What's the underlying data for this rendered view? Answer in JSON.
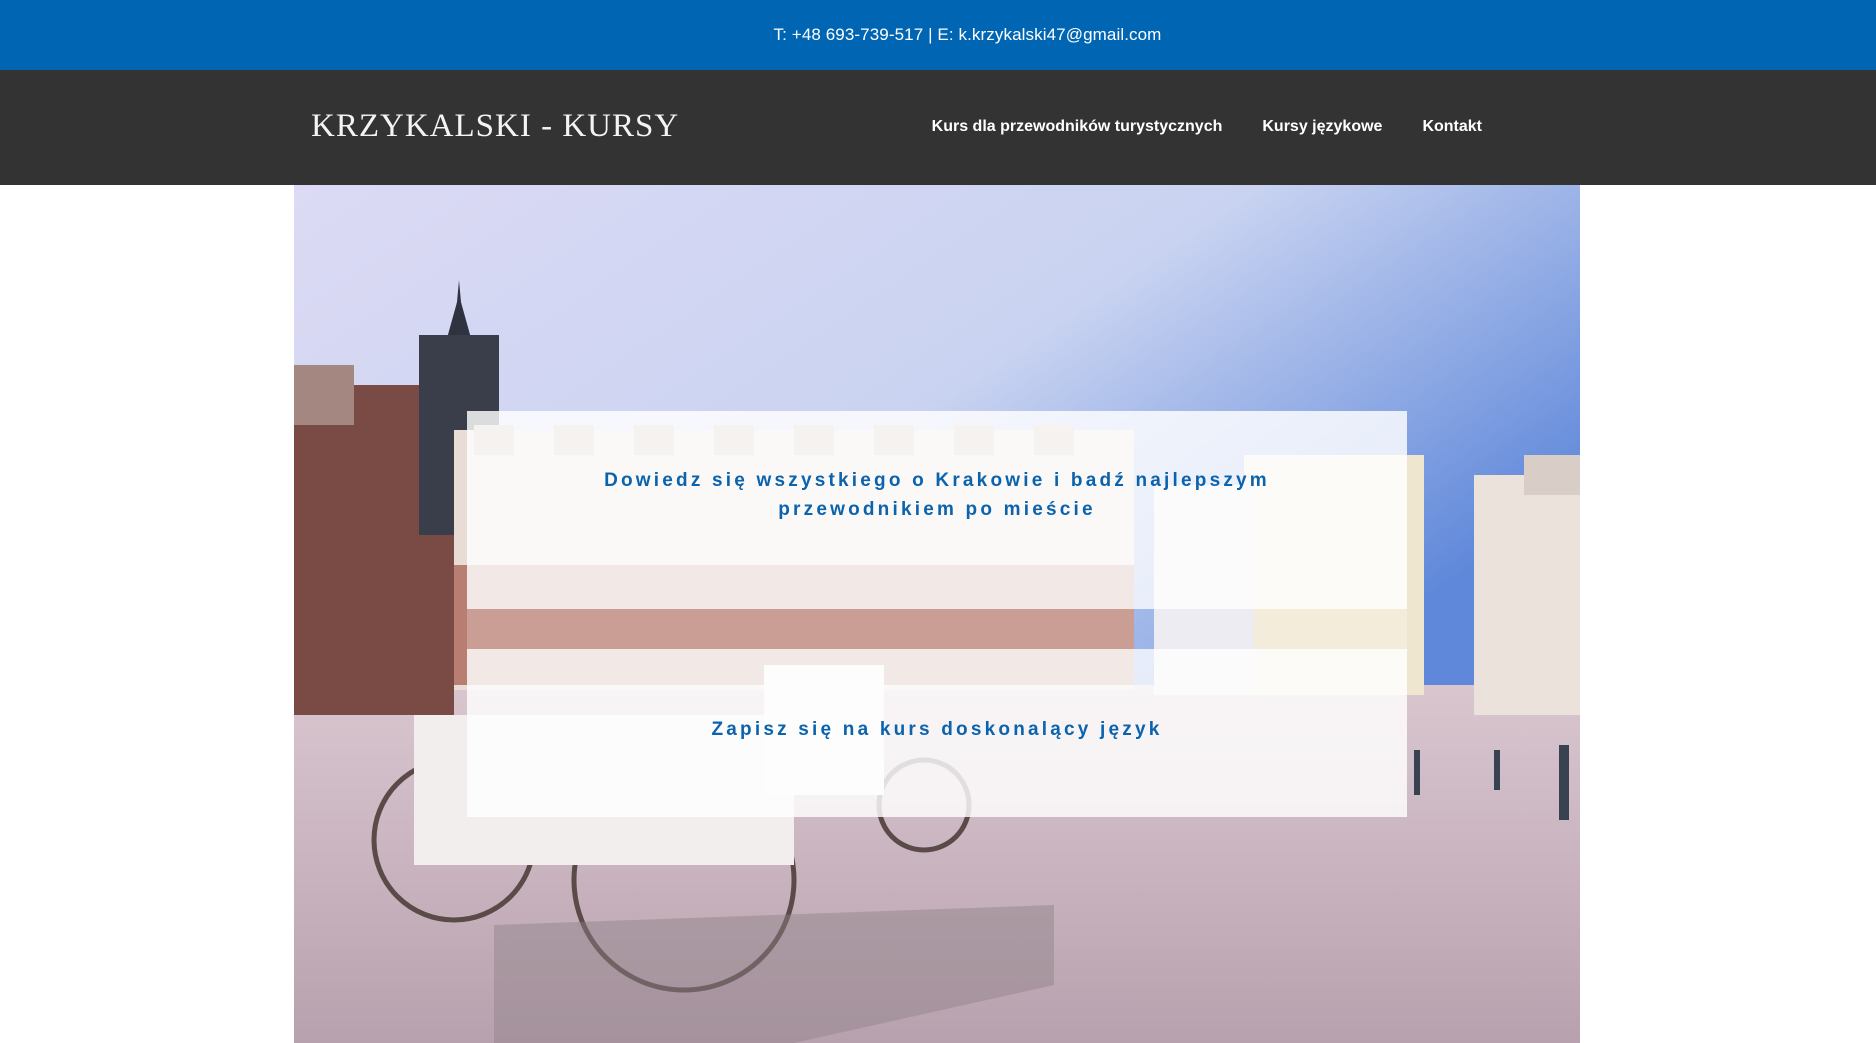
{
  "topbar": {
    "contact": "T: +48 693-739-517 | E: k.krzykalski47@gmail.com",
    "background_color": "#0066b3"
  },
  "header": {
    "site_title": "KRZYKALSKI - KURSY",
    "background_color": "#333333",
    "nav": [
      {
        "label": "Kurs dla przewodników turystycznych"
      },
      {
        "label": "Kursy językowe"
      },
      {
        "label": "Kontakt"
      }
    ]
  },
  "hero": {
    "image_description_icon": "krakow-market-square-photo",
    "panel_top_text": "Dowiedz się wszystkiego o Krakowie i badź najlepszym przewodnikiem po mieście",
    "panel_bottom_text": "Zapisz się na kurs doskonalący język",
    "text_color": "#0b63ae"
  }
}
